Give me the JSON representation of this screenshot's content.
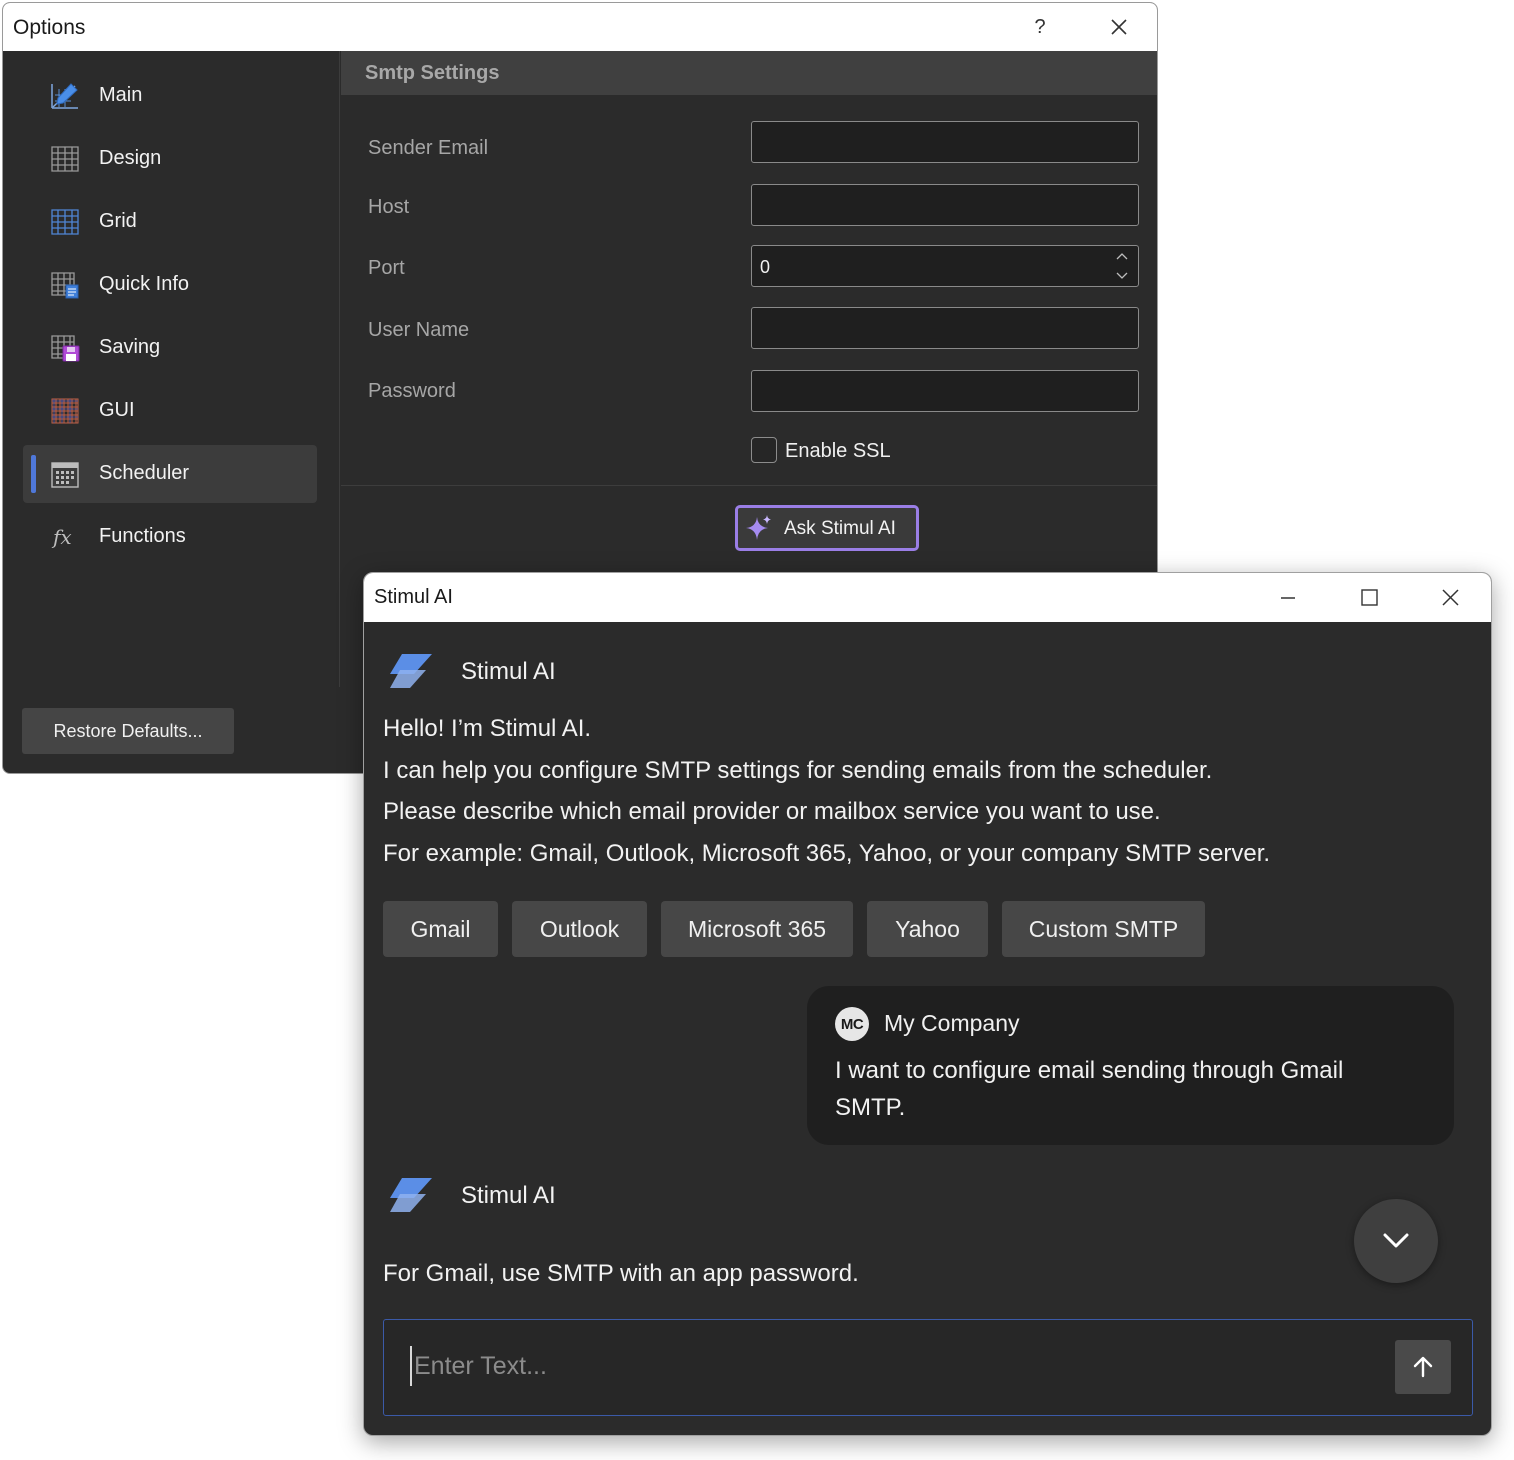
{
  "options_window": {
    "title": "Options",
    "help_label": "?",
    "nav": [
      {
        "label": "Main",
        "icon": "main-settings-icon"
      },
      {
        "label": "Design",
        "icon": "design-grid-icon"
      },
      {
        "label": "Grid",
        "icon": "grid-icon"
      },
      {
        "label": "Quick Info",
        "icon": "quick-info-icon"
      },
      {
        "label": "Saving",
        "icon": "saving-icon"
      },
      {
        "label": "GUI",
        "icon": "gui-icon"
      },
      {
        "label": "Scheduler",
        "icon": "scheduler-icon",
        "active": true
      },
      {
        "label": "Functions",
        "icon": "functions-icon"
      }
    ],
    "restore_label": "Restore Defaults...",
    "section_title": "Smtp Settings",
    "fields": {
      "sender_email": {
        "label": "Sender Email",
        "value": ""
      },
      "host": {
        "label": "Host",
        "value": ""
      },
      "port": {
        "label": "Port",
        "value": "0"
      },
      "user_name": {
        "label": "User Name",
        "value": ""
      },
      "password": {
        "label": "Password",
        "value": ""
      }
    },
    "ssl": {
      "label": "Enable SSL",
      "checked": false
    },
    "ask_button": "Ask Stimul AI",
    "accent_color": "#9a7ee6"
  },
  "ai_window": {
    "title": "Stimul AI",
    "bot_name": "Stimul AI",
    "greeting_lines": [
      "Hello! I’m Stimul AI.",
      "I can help you configure SMTP settings for sending emails from the scheduler.",
      "Please describe which email provider or mailbox service you want to use.",
      "For example: Gmail, Outlook, Microsoft 365, Yahoo, or your company SMTP server."
    ],
    "chips": [
      "Gmail",
      "Outlook",
      "Microsoft 365",
      "Yahoo",
      "Custom SMTP"
    ],
    "user": {
      "initials": "MC",
      "name": "My Company",
      "message": "I want to configure email sending through Gmail SMTP."
    },
    "reply": "For Gmail, use SMTP with an app password.",
    "input_placeholder": "Enter Text...",
    "input_border_color": "#3b5aa8"
  }
}
